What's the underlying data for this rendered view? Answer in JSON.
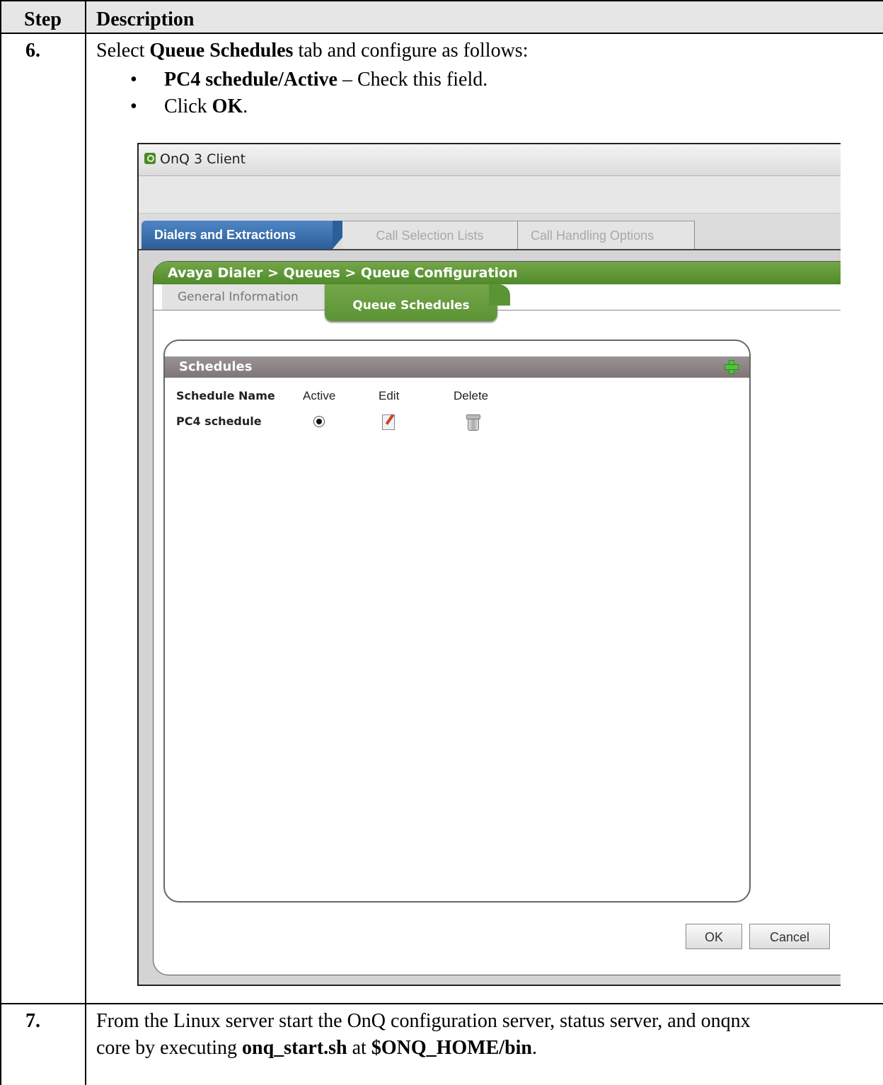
{
  "doc": {
    "header": {
      "step": "Step",
      "description": "Description"
    },
    "row6": {
      "step": "6.",
      "intro_prefix": "Select ",
      "intro_bold": "Queue Schedules",
      "intro_suffix": " tab and configure as follows:",
      "bullet1_bold": "PC4 schedule/Active",
      "bullet1_rest": " – Check this field.",
      "bullet2_prefix": "Click ",
      "bullet2_bold": "OK",
      "bullet2_suffix": "."
    },
    "row7": {
      "step": "7.",
      "line1": "From the Linux server start the OnQ configuration server, status server, and onqnx",
      "line2_prefix": "core by executing ",
      "line2_bold1": "onq_start.sh",
      "line2_mid": " at ",
      "line2_bold2": "$ONQ_HOME/bin",
      "line2_suffix": "."
    }
  },
  "app": {
    "window_title": "OnQ 3 Client",
    "main_tabs": [
      {
        "label": "Dialers and Extractions",
        "active": true
      },
      {
        "label": "Call Selection Lists",
        "active": false
      },
      {
        "label": "Call Handling Options",
        "active": false
      }
    ],
    "breadcrumb": "Avaya Dialer > Queues > Queue Configuration",
    "sub_tabs": [
      {
        "label": "General Information",
        "active": false
      },
      {
        "label": "Queue Schedules",
        "active": true
      }
    ],
    "schedules": {
      "title": "Schedules",
      "columns": [
        "Schedule Name",
        "Active",
        "Edit",
        "Delete"
      ],
      "rows": [
        {
          "name": "PC4 schedule",
          "active": true
        }
      ]
    },
    "buttons": {
      "ok": "OK",
      "cancel": "Cancel"
    },
    "colors": {
      "tab_blue": "#2c5f9a",
      "breadcrumb_green": "#5b9434",
      "panel_header_gray": "#7e7676"
    },
    "icons": [
      "app-icon",
      "add-schedule-icon",
      "edit-icon",
      "trash-icon"
    ]
  }
}
